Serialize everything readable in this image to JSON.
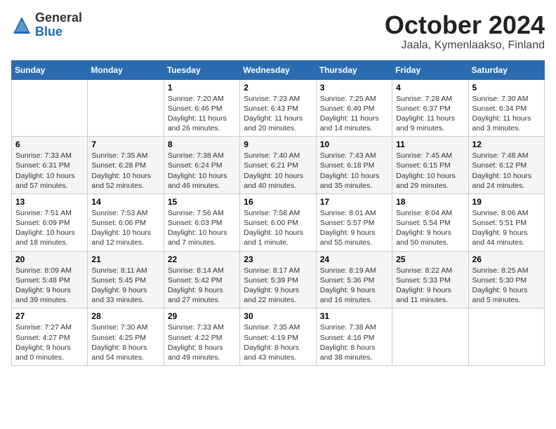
{
  "logo": {
    "general": "General",
    "blue": "Blue"
  },
  "header": {
    "month": "October 2024",
    "location": "Jaala, Kymenlaakso, Finland"
  },
  "weekdays": [
    "Sunday",
    "Monday",
    "Tuesday",
    "Wednesday",
    "Thursday",
    "Friday",
    "Saturday"
  ],
  "weeks": [
    [
      {
        "day": null,
        "info": null
      },
      {
        "day": null,
        "info": null
      },
      {
        "day": "1",
        "info": "Sunrise: 7:20 AM\nSunset: 6:46 PM\nDaylight: 11 hours\nand 26 minutes."
      },
      {
        "day": "2",
        "info": "Sunrise: 7:23 AM\nSunset: 6:43 PM\nDaylight: 11 hours\nand 20 minutes."
      },
      {
        "day": "3",
        "info": "Sunrise: 7:25 AM\nSunset: 6:40 PM\nDaylight: 11 hours\nand 14 minutes."
      },
      {
        "day": "4",
        "info": "Sunrise: 7:28 AM\nSunset: 6:37 PM\nDaylight: 11 hours\nand 9 minutes."
      },
      {
        "day": "5",
        "info": "Sunrise: 7:30 AM\nSunset: 6:34 PM\nDaylight: 11 hours\nand 3 minutes."
      }
    ],
    [
      {
        "day": "6",
        "info": "Sunrise: 7:33 AM\nSunset: 6:31 PM\nDaylight: 10 hours\nand 57 minutes."
      },
      {
        "day": "7",
        "info": "Sunrise: 7:35 AM\nSunset: 6:28 PM\nDaylight: 10 hours\nand 52 minutes."
      },
      {
        "day": "8",
        "info": "Sunrise: 7:38 AM\nSunset: 6:24 PM\nDaylight: 10 hours\nand 46 minutes."
      },
      {
        "day": "9",
        "info": "Sunrise: 7:40 AM\nSunset: 6:21 PM\nDaylight: 10 hours\nand 40 minutes."
      },
      {
        "day": "10",
        "info": "Sunrise: 7:43 AM\nSunset: 6:18 PM\nDaylight: 10 hours\nand 35 minutes."
      },
      {
        "day": "11",
        "info": "Sunrise: 7:45 AM\nSunset: 6:15 PM\nDaylight: 10 hours\nand 29 minutes."
      },
      {
        "day": "12",
        "info": "Sunrise: 7:48 AM\nSunset: 6:12 PM\nDaylight: 10 hours\nand 24 minutes."
      }
    ],
    [
      {
        "day": "13",
        "info": "Sunrise: 7:51 AM\nSunset: 6:09 PM\nDaylight: 10 hours\nand 18 minutes."
      },
      {
        "day": "14",
        "info": "Sunrise: 7:53 AM\nSunset: 6:06 PM\nDaylight: 10 hours\nand 12 minutes."
      },
      {
        "day": "15",
        "info": "Sunrise: 7:56 AM\nSunset: 6:03 PM\nDaylight: 10 hours\nand 7 minutes."
      },
      {
        "day": "16",
        "info": "Sunrise: 7:58 AM\nSunset: 6:00 PM\nDaylight: 10 hours\nand 1 minute."
      },
      {
        "day": "17",
        "info": "Sunrise: 8:01 AM\nSunset: 5:57 PM\nDaylight: 9 hours\nand 55 minutes."
      },
      {
        "day": "18",
        "info": "Sunrise: 8:04 AM\nSunset: 5:54 PM\nDaylight: 9 hours\nand 50 minutes."
      },
      {
        "day": "19",
        "info": "Sunrise: 8:06 AM\nSunset: 5:51 PM\nDaylight: 9 hours\nand 44 minutes."
      }
    ],
    [
      {
        "day": "20",
        "info": "Sunrise: 8:09 AM\nSunset: 5:48 PM\nDaylight: 9 hours\nand 39 minutes."
      },
      {
        "day": "21",
        "info": "Sunrise: 8:11 AM\nSunset: 5:45 PM\nDaylight: 9 hours\nand 33 minutes."
      },
      {
        "day": "22",
        "info": "Sunrise: 8:14 AM\nSunset: 5:42 PM\nDaylight: 9 hours\nand 27 minutes."
      },
      {
        "day": "23",
        "info": "Sunrise: 8:17 AM\nSunset: 5:39 PM\nDaylight: 9 hours\nand 22 minutes."
      },
      {
        "day": "24",
        "info": "Sunrise: 8:19 AM\nSunset: 5:36 PM\nDaylight: 9 hours\nand 16 minutes."
      },
      {
        "day": "25",
        "info": "Sunrise: 8:22 AM\nSunset: 5:33 PM\nDaylight: 9 hours\nand 11 minutes."
      },
      {
        "day": "26",
        "info": "Sunrise: 8:25 AM\nSunset: 5:30 PM\nDaylight: 9 hours\nand 5 minutes."
      }
    ],
    [
      {
        "day": "27",
        "info": "Sunrise: 7:27 AM\nSunset: 4:27 PM\nDaylight: 9 hours\nand 0 minutes."
      },
      {
        "day": "28",
        "info": "Sunrise: 7:30 AM\nSunset: 4:25 PM\nDaylight: 8 hours\nand 54 minutes."
      },
      {
        "day": "29",
        "info": "Sunrise: 7:33 AM\nSunset: 4:22 PM\nDaylight: 8 hours\nand 49 minutes."
      },
      {
        "day": "30",
        "info": "Sunrise: 7:35 AM\nSunset: 4:19 PM\nDaylight: 8 hours\nand 43 minutes."
      },
      {
        "day": "31",
        "info": "Sunrise: 7:38 AM\nSunset: 4:16 PM\nDaylight: 8 hours\nand 38 minutes."
      },
      {
        "day": null,
        "info": null
      },
      {
        "day": null,
        "info": null
      }
    ]
  ]
}
